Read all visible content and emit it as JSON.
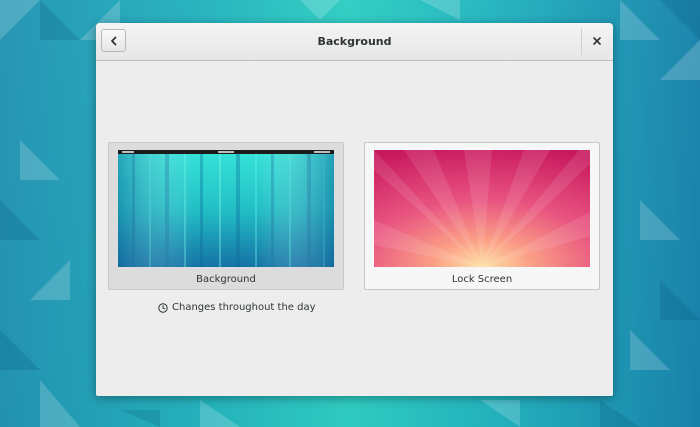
{
  "window": {
    "title": "Background"
  },
  "tiles": [
    {
      "label": "Background",
      "selected": true,
      "thumb": "teal-streaks-wallpaper"
    },
    {
      "label": "Lock Screen",
      "selected": false,
      "thumb": "pink-sunburst-wallpaper"
    }
  ],
  "info": {
    "text": "Changes throughout the day",
    "icon": "clock-icon"
  },
  "colors": {
    "desktop_teal": "#20b4be",
    "sunburst_pink": "#d8326e",
    "sunburst_glow": "#fde4a8"
  }
}
